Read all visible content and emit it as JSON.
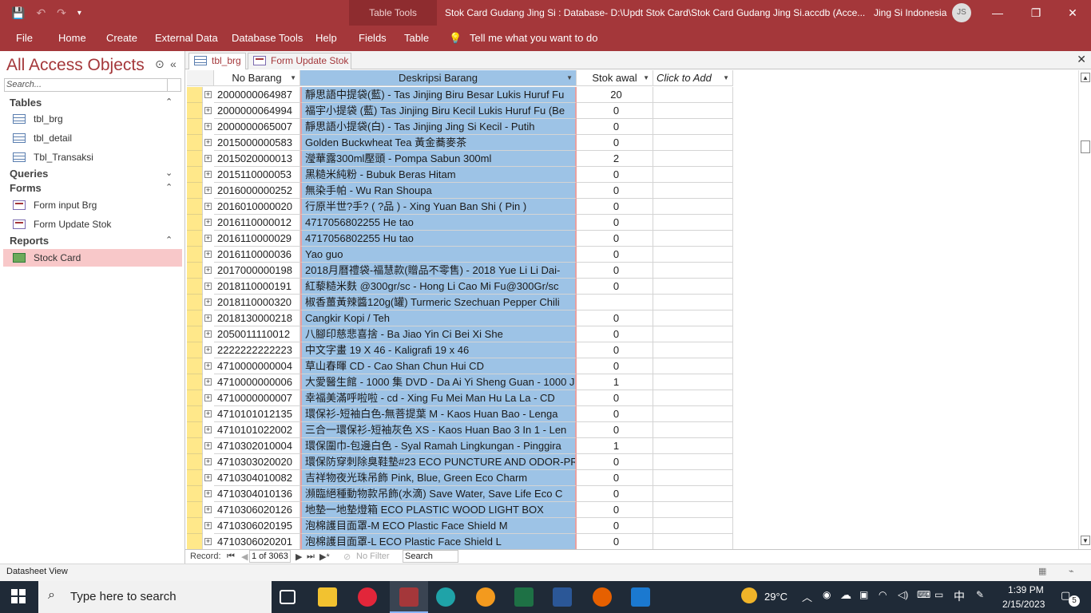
{
  "titlebar": {
    "context_group": "Table Tools",
    "title": "Stok Card Gudang Jing Si : Database- D:\\Updt Stok Card\\Stok Card Gudang Jing Si.accdb (Acce...",
    "user_name": "Jing Si Indonesia",
    "user_initials": "JS"
  },
  "ribbon": {
    "tabs": [
      "File",
      "Home",
      "Create",
      "External Data",
      "Database Tools",
      "Help",
      "Fields",
      "Table"
    ],
    "tell_me": "Tell me what you want to do"
  },
  "nav": {
    "title": "All Access Objects",
    "search_placeholder": "Search...",
    "groups": {
      "tables": "Tables",
      "queries": "Queries",
      "forms": "Forms",
      "reports": "Reports"
    },
    "tables": [
      "tbl_brg",
      "tbl_detail",
      "Tbl_Transaksi"
    ],
    "forms": [
      "Form input Brg",
      "Form Update Stok"
    ],
    "reports": [
      "Stock Card"
    ]
  },
  "doc_tabs": [
    "tbl_brg",
    "Form Update Stok"
  ],
  "grid": {
    "columns": [
      "No Barang",
      "Deskripsi Barang",
      "Stok awal",
      "Click to Add"
    ],
    "rows": [
      [
        "2000000064987",
        "靜思語中提袋(藍) - Tas Jinjing Biru Besar Lukis Huruf Fu",
        "20"
      ],
      [
        "2000000064994",
        "福宇小提袋 (藍) Tas Jinjing Biru Kecil Lukis Huruf Fu (Be",
        "0"
      ],
      [
        "2000000065007",
        "靜思語小提袋(白) - Tas Jinjing Jing Si Kecil - Putih",
        "0"
      ],
      [
        "2015000000583",
        "Golden Buckwheat Tea 黃金蕎麥茶",
        "0"
      ],
      [
        "2015020000013",
        "瀅華露300ml壓頭 - Pompa Sabun 300ml",
        "2"
      ],
      [
        "2015110000053",
        "黑糙米純粉 - Bubuk Beras Hitam",
        "0"
      ],
      [
        "2016000000252",
        "無染手帕 - Wu Ran Shoupa",
        "0"
      ],
      [
        "2016010000020",
        "行原半世?手? ( ?品 ) - Xing Yuan Ban Shi ( Pin )",
        "0"
      ],
      [
        "2016110000012",
        "4717056802255 He tao",
        "0"
      ],
      [
        "2016110000029",
        "4717056802255 Hu tao",
        "0"
      ],
      [
        "2016110000036",
        "Yao guo",
        "0"
      ],
      [
        "2017000000198",
        "2018月曆禮袋-福慧款(贈品不零售) - 2018 Yue Li Li Dai-",
        "0"
      ],
      [
        "2018110000191",
        "紅藜糙米麩 @300gr/sc - Hong Li Cao Mi Fu@300Gr/sc",
        "0"
      ],
      [
        "2018110000320",
        "椒香薑黃辣醬120g(罐) Turmeric Szechuan Pepper Chili",
        ""
      ],
      [
        "2018130000218",
        "Cangkir Kopi / Teh",
        "0"
      ],
      [
        "2050011110012",
        "八腳印慈悲喜捨 - Ba Jiao Yin Ci Bei Xi She",
        "0"
      ],
      [
        "2222222222223",
        "中文字畫  19 X 46 - Kaligrafi 19 x 46",
        "0"
      ],
      [
        "4710000000004",
        "草山春暉 CD - Cao Shan Chun Hui CD",
        "0"
      ],
      [
        "4710000000006",
        "大愛醫生館 - 1000 集 DVD - Da Ai Yi Sheng Guan - 1000 J",
        "1"
      ],
      [
        "4710000000007",
        "幸福美滿呼啦啦 - cd - Xing Fu Mei Man Hu La La - CD",
        "0"
      ],
      [
        "4710101012135",
        "環保衫-短袖白色-無菩提葉 M - Kaos Huan Bao  - Lenga",
        "0"
      ],
      [
        "4710101022002",
        "三合一環保衫-短袖灰色 XS - Kaos Huan Bao 3 In 1 - Len",
        "0"
      ],
      [
        "4710302010004",
        "環保圍巾-包邊白色 - Syal Ramah Lingkungan - Pinggira",
        "1"
      ],
      [
        "4710303020020",
        "環保防穿刺除臭鞋墊#23 ECO PUNCTURE AND ODOR-PR",
        "0"
      ],
      [
        "4710304010082",
        "吉祥物夜光珠吊飾 Pink, Blue, Green Eco Charm",
        "0"
      ],
      [
        "4710304010136",
        "瀕臨絕種動物款吊飾(水滴) Save Water, Save Life Eco C",
        "0"
      ],
      [
        "4710306020126",
        "地墊一地墊燈箱 ECO PLASTIC WOOD LIGHT BOX",
        "0"
      ],
      [
        "4710306020195",
        "泡棉護目面罩-M ECO Plastic Face Shield M",
        "0"
      ],
      [
        "4710306020201",
        "泡棉護目面罩-L ECO Plastic Face Shield L",
        "0"
      ]
    ]
  },
  "record_nav": {
    "label": "Record:",
    "position": "1 of 3063",
    "filter": "No Filter",
    "search": "Search"
  },
  "status": {
    "view": "Datasheet View"
  },
  "taskbar": {
    "search_placeholder": "Type here to search",
    "weather": "29°C",
    "ime": "中",
    "time": "1:39 PM",
    "date": "2/15/2023",
    "notifications": "5"
  }
}
